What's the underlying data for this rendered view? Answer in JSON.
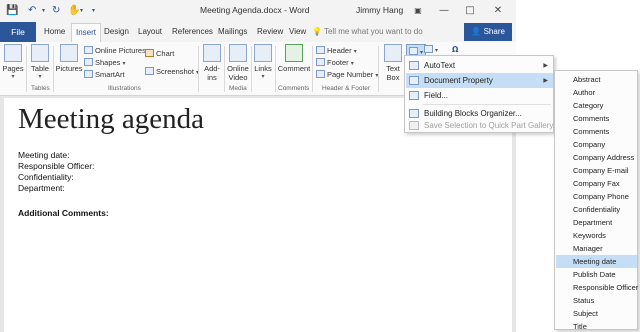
{
  "window": {
    "title": "Meeting Agenda.docx  -  Word",
    "user": "Jimmy Hang"
  },
  "qat": {
    "save_icon": "save-icon",
    "undo_icon": "undo-icon",
    "redo_icon": "redo-icon",
    "customize_icon": "customize-icon"
  },
  "tabs": {
    "file": "File",
    "items": [
      "Home",
      "Insert",
      "Design",
      "Layout",
      "References",
      "Mailings",
      "Review",
      "View"
    ],
    "active": "Insert",
    "tellme": "Tell me what you want to do",
    "share": "Share"
  },
  "ribbon": {
    "pages": "Pages",
    "table": "Table",
    "tables_group": "Tables",
    "pictures": "Pictures",
    "online_pictures": "Online Pictures",
    "shapes": "Shapes",
    "smartart": "SmartArt",
    "chart": "Chart",
    "screenshot": "Screenshot",
    "illustrations_group": "Illustrations",
    "addins": "Add-ins",
    "online_video": "Online Video",
    "media_group": "Media",
    "links": "Links",
    "comment": "Comment",
    "comments_group": "Comments",
    "header": "Header",
    "footer": "Footer",
    "page_number": "Page Number",
    "header_footer_group": "Header & Footer",
    "text_box": "Text Box"
  },
  "document": {
    "heading": "Meeting agenda",
    "fields": [
      "Meeting date:",
      "Responsible Officer:",
      "Confidentiality:",
      "Department:"
    ],
    "additional": "Additional Comments:"
  },
  "menu": {
    "items": [
      {
        "label": "AutoText",
        "has_submenu": true,
        "highlighted": false,
        "disabled": false
      },
      {
        "label": "Document Property",
        "has_submenu": true,
        "highlighted": true,
        "disabled": false
      },
      {
        "label": "Field...",
        "has_submenu": false,
        "highlighted": false,
        "disabled": false
      },
      {
        "label": "Building Blocks Organizer...",
        "has_submenu": false,
        "highlighted": false,
        "disabled": false
      },
      {
        "label": "Save Selection to Quick Part Gallery...",
        "has_submenu": false,
        "highlighted": false,
        "disabled": true
      }
    ]
  },
  "submenu": {
    "items": [
      "Abstract",
      "Author",
      "Category",
      "Comments",
      "Comments",
      "Company",
      "Company Address",
      "Company E-mail",
      "Company Fax",
      "Company Phone",
      "Confidentiality",
      "Department",
      "Keywords",
      "Manager",
      "Meeting date",
      "Publish Date",
      "Responsible Officer",
      "Status",
      "Subject",
      "Title"
    ],
    "highlighted": "Meeting date"
  }
}
